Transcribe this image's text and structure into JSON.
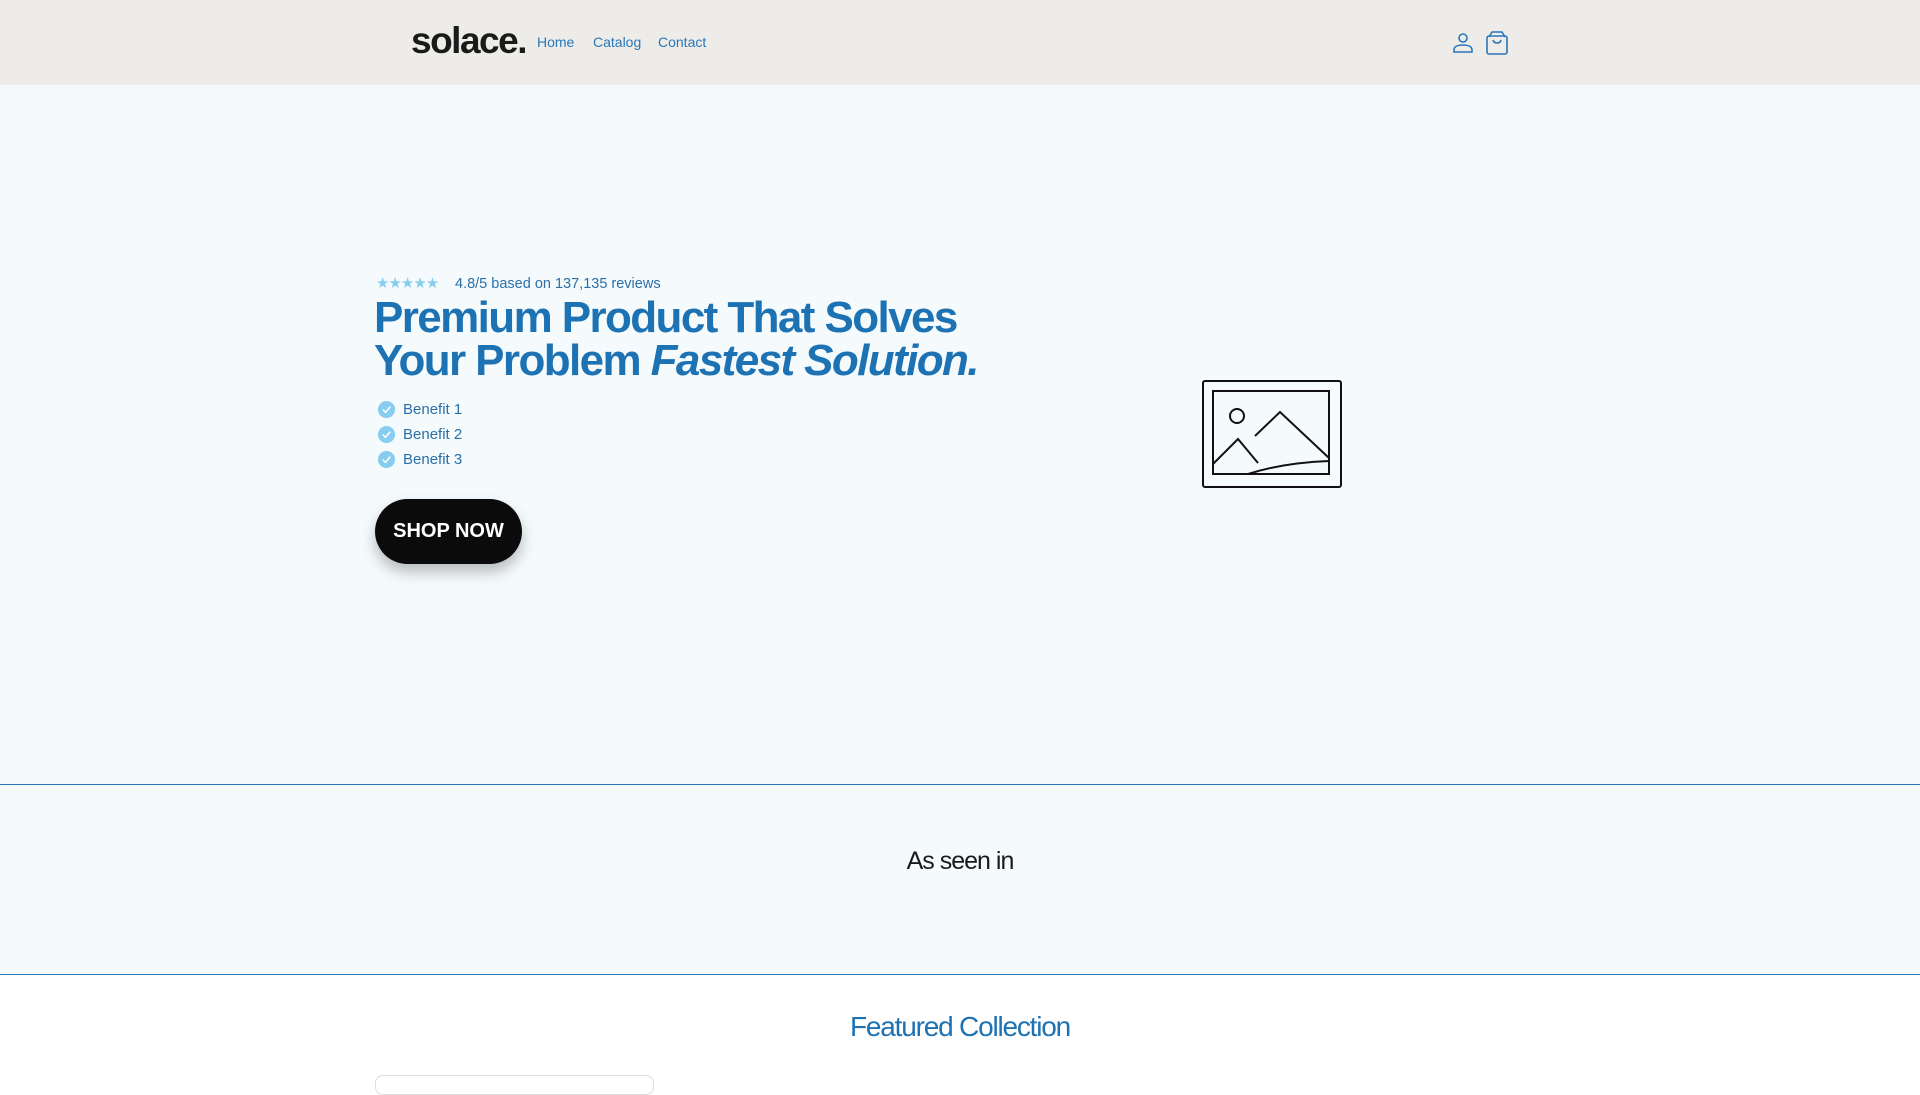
{
  "header": {
    "logo": "solace.",
    "nav": [
      {
        "label": "Home"
      },
      {
        "label": "Catalog"
      },
      {
        "label": "Contact"
      }
    ],
    "icons": [
      "user-icon",
      "cart-bag-icon"
    ]
  },
  "hero": {
    "stars": "★★★★★",
    "rating_text": "4.8/5 based on 137,135 reviews",
    "headline_line1": "Premium Product That Solves",
    "headline_line2": "Your Problem ",
    "headline_italic": "Fastest Solution.",
    "benefits": [
      "Benefit 1",
      "Benefit 2",
      "Benefit 3"
    ],
    "cta": "SHOP NOW"
  },
  "as_seen_in": {
    "title": "As seen in"
  },
  "featured": {
    "title": "Featured Collection"
  },
  "colors": {
    "accent": "#1d72b3",
    "header_bg": "#eeece8",
    "hero_bg": "#f5fafd",
    "check": "#86cdf0"
  }
}
